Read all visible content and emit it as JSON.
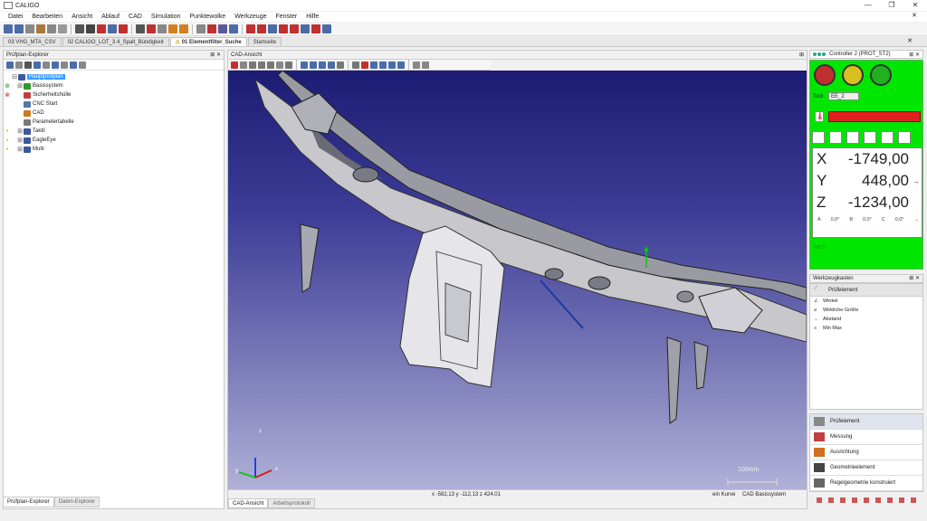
{
  "app": {
    "title": "CALIGO"
  },
  "window": {
    "minimize": "—",
    "maximize": "❐",
    "close": "✕"
  },
  "menu": [
    "Datei",
    "Bearbeiten",
    "Ansicht",
    "Ablauf",
    "CAD",
    "Simulation",
    "Punktewolke",
    "Werkzeuge",
    "Fenster",
    "Hilfe"
  ],
  "menu_close": "✕",
  "tabs": [
    {
      "label": "03 VHG_MTA_CSV",
      "active": false
    },
    {
      "label": "02 CALIGO_LOT_3.4_Spalt_Bündigkeit",
      "active": false
    },
    {
      "label": "01 Elementfilter_Suche",
      "active": true
    },
    {
      "label": "Startseite",
      "active": false
    }
  ],
  "tab_warning_icon": "⚠",
  "tabs_close": "✕",
  "left_panel": {
    "title": "Prüfplan-Explorer",
    "pin": "⊞ ✕",
    "tree": [
      {
        "indent": 0,
        "exp": "⊟",
        "label": "Hauptprüfplan",
        "selected": true,
        "color": "#3c5a9a",
        "marker": ""
      },
      {
        "indent": 1,
        "exp": "⊞",
        "label": "Basissystem",
        "selected": false,
        "color": "#2a9a2a",
        "marker": "⊕"
      },
      {
        "indent": 1,
        "exp": "",
        "label": "Sicherheitshülle",
        "selected": false,
        "color": "#c04040",
        "marker": "⊗"
      },
      {
        "indent": 1,
        "exp": "",
        "label": "CNC Start",
        "selected": false,
        "color": "#5577aa",
        "marker": ""
      },
      {
        "indent": 1,
        "exp": "",
        "label": "CAD",
        "selected": false,
        "color": "#cc7a20",
        "marker": ""
      },
      {
        "indent": 1,
        "exp": "",
        "label": "Parametertabelle",
        "selected": false,
        "color": "#777777",
        "marker": ""
      },
      {
        "indent": 1,
        "exp": "⊞",
        "label": "Taktil",
        "selected": false,
        "color": "#3c5a9a",
        "marker": "•"
      },
      {
        "indent": 1,
        "exp": "⊞",
        "label": "EagleEye",
        "selected": false,
        "color": "#3c5a9a",
        "marker": "•"
      },
      {
        "indent": 1,
        "exp": "⊞",
        "label": "Multi",
        "selected": false,
        "color": "#3c5a9a",
        "marker": "•"
      }
    ],
    "bottom_tabs": [
      {
        "label": "Prüfplan-Explorer",
        "active": true
      },
      {
        "label": "Daten-Explorer",
        "active": false
      }
    ]
  },
  "cad": {
    "title": "CAD-Ansicht",
    "pin": "⊞",
    "scale_label": "100mm",
    "axes": {
      "x": "x",
      "y": "y",
      "z": "z"
    },
    "coords_text": "x -582,13  y -112,13  z 424,01",
    "curve_text": "ein Kurve",
    "system_text": "CAD Basissystem",
    "bottom_tabs": [
      {
        "label": "CAD-Ansicht",
        "active": true
      },
      {
        "label": "Arbeitsprotokoll",
        "active": false
      }
    ]
  },
  "controller": {
    "title": "Controller 2 (PROT_ST2)",
    "pin": "⊞ ✕",
    "tool_label": "Tool",
    "tool_value": "EE_2",
    "x_label": "X",
    "x_value": "-1749,00",
    "y_label": "Y",
    "y_value": "448,00",
    "z_label": "Z",
    "z_value": "-1234,00",
    "a_label": "A",
    "a_value": "0,0°",
    "b_label": "B",
    "b_value": "0,0°",
    "c_label": "C",
    "c_value": "0,0°",
    "mode": "WKS",
    "stop_color": "#c03030",
    "pause_color": "#d8c020",
    "play_color": "#20b020"
  },
  "werkzeugkasten": {
    "title": "Werkzeugkasten",
    "pin": "⊞ ✕",
    "header": "Prüfelement",
    "items": [
      {
        "glyph": "∠",
        "label": "Winkel"
      },
      {
        "glyph": "⌀",
        "label": "Wirkliche Größe"
      },
      {
        "glyph": "↔",
        "label": "Abstand"
      },
      {
        "glyph": "≡",
        "label": "Min Max"
      }
    ]
  },
  "categories": [
    {
      "label": "Prüfelement",
      "active": true,
      "color": "#888888"
    },
    {
      "label": "Messung",
      "active": false,
      "color": "#c04040"
    },
    {
      "label": "Ausrichtung",
      "active": false,
      "color": "#d07020"
    },
    {
      "label": "Geometrieelement",
      "active": false,
      "color": "#444444"
    },
    {
      "label": "Regelgeometrie konstruiert",
      "active": false,
      "color": "#666666"
    }
  ]
}
